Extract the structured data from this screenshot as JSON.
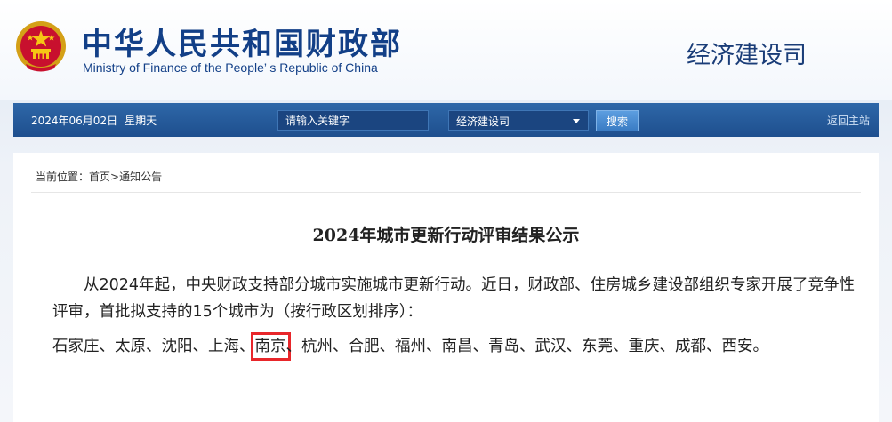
{
  "header": {
    "title_cn": "中华人民共和国财政部",
    "title_en": "Ministry of Finance of the People’ s Republic of China",
    "department": "经济建设司"
  },
  "navbar": {
    "date": "2024年06月02日",
    "weekday": "星期天",
    "search_placeholder": "请输入关键字",
    "select_value": "经济建设司",
    "search_button": "搜索",
    "home_link": "返回主站"
  },
  "breadcrumb": {
    "label": "当前位置：",
    "home": "首页",
    "sep": ">",
    "current": "通知公告"
  },
  "article": {
    "title": "2024年城市更新行动评审结果公示",
    "paragraph": "从2024年起，中央财政支持部分城市实施城市更新行动。近日，财政部、住房城乡建设部组织专家开展了竞争性评审，首批拟支持的15个城市为（按行政区划排序）：",
    "cities_before": "石家庄、太原、沈阳、上海、",
    "city_highlight": "南京",
    "cities_after": "、杭州、合肥、福州、南昌、青岛、武汉、东莞、重庆、成都、西安。"
  },
  "colors": {
    "brand_blue": "#123f87",
    "nav_blue": "#1e4f8e",
    "highlight_red": "#e8262a"
  }
}
